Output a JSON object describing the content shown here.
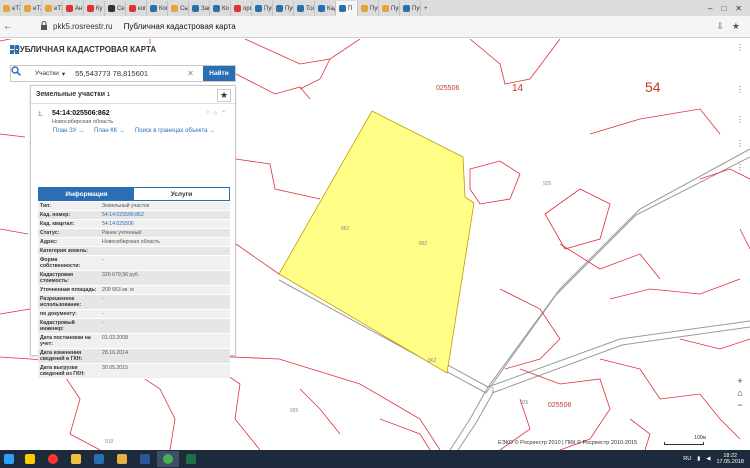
{
  "browser": {
    "tabs": [
      {
        "label": "eTX",
        "icon": "etx-favicon-icon",
        "color": "#e8a33c"
      },
      {
        "label": "eTX",
        "icon": "etx-favicon-icon",
        "color": "#e8a33c"
      },
      {
        "label": "eTX",
        "icon": "etx-favicon-icon",
        "color": "#e8a33c"
      },
      {
        "label": "Ант",
        "icon": "chrome-favicon-icon",
        "color": "#d33"
      },
      {
        "label": "Ку",
        "icon": "yandex-favicon-icon",
        "color": "#d33"
      },
      {
        "label": "Се",
        "icon": "avito-favicon-icon",
        "color": "#333"
      },
      {
        "label": "ког",
        "icon": "yandex-favicon-icon",
        "color": "#d33"
      },
      {
        "label": "Ког",
        "icon": "rosreestr-favicon-icon",
        "color": "#2a6fb3"
      },
      {
        "label": "Сы",
        "icon": "mail-favicon-icon",
        "color": "#e8a33c"
      },
      {
        "label": "Зак",
        "icon": "rosreestr-favicon-icon",
        "color": "#2a6fb3"
      },
      {
        "label": "Ко",
        "icon": "rosreestr-favicon-icon",
        "color": "#2a6fb3"
      },
      {
        "label": "орг",
        "icon": "yandex-favicon-icon",
        "color": "#d33"
      },
      {
        "label": "Пуб",
        "icon": "rosreestr-favicon-icon",
        "color": "#2a6fb3"
      },
      {
        "label": "Пуб",
        "icon": "rosreestr-favicon-icon",
        "color": "#2a6fb3"
      },
      {
        "label": "Тол",
        "icon": "rosreestr-favicon-icon",
        "color": "#2a6fb3"
      },
      {
        "label": "Кад",
        "icon": "rosreestr-favicon-icon",
        "color": "#2a6fb3"
      },
      {
        "label": "П",
        "icon": "rosreestr-favicon-icon",
        "color": "#2a6fb3",
        "active": true
      },
      {
        "label": "Пуб",
        "icon": "rosreestr-favicon-icon",
        "color": "#e8a33c"
      },
      {
        "label": "Пуб",
        "icon": "rosreestr-favicon-icon",
        "color": "#e8a33c"
      },
      {
        "label": "Пуб",
        "icon": "rosreestr-favicon-icon",
        "color": "#2a6fb3"
      }
    ],
    "url_host": "pkk5.rosreestr.ru",
    "page_title": "Публичная кадастровая карта"
  },
  "app": {
    "title": "ПУБЛИЧНАЯ КАДАСТРОВАЯ КАРТА",
    "search": {
      "type_label": "Участки",
      "query": "55,543773 78,815601",
      "find_label": "Найти"
    }
  },
  "panel": {
    "heading": "Земельные участки",
    "count": "1",
    "result": {
      "index": "1.",
      "cad_number": "54:14:025506:862",
      "region": "Новосибирская область",
      "links": [
        "План ЗУ →",
        "План КК →",
        "Поиск в границах объекта →"
      ]
    },
    "tabs": {
      "info": "Информация",
      "services": "Услуги"
    },
    "properties": [
      {
        "k": "Тип:",
        "v": "Земельный участок"
      },
      {
        "k": "Кад. номер:",
        "v": "54:14:025506:862",
        "link": true
      },
      {
        "k": "Кад. квартал:",
        "v": "54:14:025506",
        "link": true
      },
      {
        "k": "Статус:",
        "v": "Ранее учтенный"
      },
      {
        "k": "Адрес:",
        "v": "Новосибирская область"
      },
      {
        "k": "Категория земель:",
        "v": ""
      },
      {
        "k": "Форма собственности:",
        "v": "-"
      },
      {
        "k": "Кадастровая стоимость:",
        "v": "320 679,56 руб."
      },
      {
        "k": "Уточненная площадь:",
        "v": "209 663 кв. м"
      },
      {
        "k": "Разрешенное использование:",
        "v": "-"
      },
      {
        "k": "по документу:",
        "v": "-"
      },
      {
        "k": "Кадастровый инженер:",
        "v": "-"
      },
      {
        "k": "Дата постановки на учет:",
        "v": "01.03.2008"
      },
      {
        "k": "Дата изменения сведений в ГКН:",
        "v": "28.10.2014"
      },
      {
        "k": "Дата выгрузки сведений из ГКН:",
        "v": "30.05.2015"
      }
    ]
  },
  "map": {
    "labels": {
      "block_top": "025506",
      "block_right": "025506",
      "num14": "14",
      "num54": "54",
      "parcel_a": "862",
      "parcel_b": "862",
      "parcel_c": "862",
      "l925a": "925",
      "l925b": "925",
      "l925c": "925",
      "l3": "3",
      "l910": "910"
    },
    "copyright": "ЕЭКО © Росреестр 2010 | ПКК © Росреестр 2010-2015",
    "scale_label": "100м",
    "colors": {
      "parcel_fill": "#ffff88",
      "boundary": "#e0303c",
      "road": "#9a9a9a",
      "accent": "#2a6fb3"
    }
  },
  "taskbar": {
    "apps": [
      "windows-start-icon",
      "yandex-browser-icon",
      "yandex-icon",
      "files-icon",
      "vk-icon",
      "folder-icon",
      "word-icon",
      "chrome-icon",
      "excel-icon"
    ],
    "lang": "RU",
    "time": "18:22",
    "date": "17.05.2018"
  }
}
